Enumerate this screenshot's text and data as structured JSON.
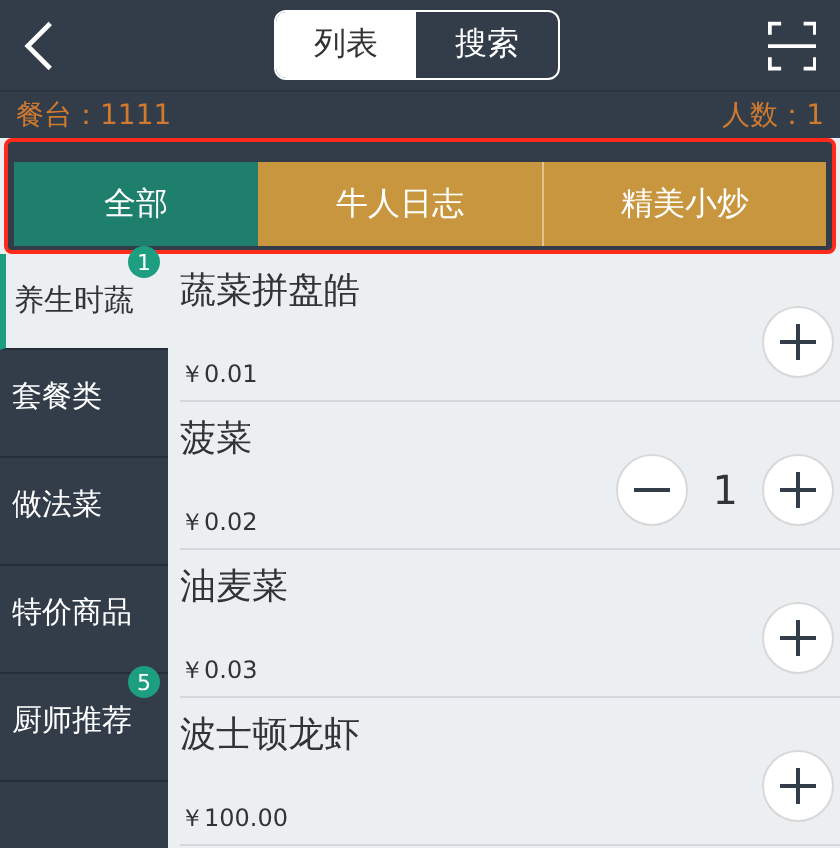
{
  "header": {
    "segments": [
      {
        "label": "列表",
        "selected": true
      },
      {
        "label": "搜索",
        "selected": false
      }
    ]
  },
  "info": {
    "table": "餐台：1111",
    "guests": "人数：1"
  },
  "tabs": [
    {
      "label": "全部",
      "selected": true
    },
    {
      "label": "牛人日志",
      "selected": false
    },
    {
      "label": "精美小炒",
      "selected": false
    }
  ],
  "sidebar": {
    "items": [
      {
        "label": "养生时蔬",
        "selected": true,
        "badge": "1"
      },
      {
        "label": "套餐类",
        "selected": false
      },
      {
        "label": "做法菜",
        "selected": false
      },
      {
        "label": "特价商品",
        "selected": false
      },
      {
        "label": "厨师推荐",
        "selected": false,
        "badge": "5"
      }
    ]
  },
  "products": [
    {
      "name": "蔬菜拼盘皓",
      "price": "￥0.01"
    },
    {
      "name": "菠菜",
      "price": "￥0.02",
      "quantity": "1"
    },
    {
      "name": "油麦菜",
      "price": "￥0.03"
    },
    {
      "name": "波士顿龙虾",
      "price": "￥100.00"
    }
  ]
}
